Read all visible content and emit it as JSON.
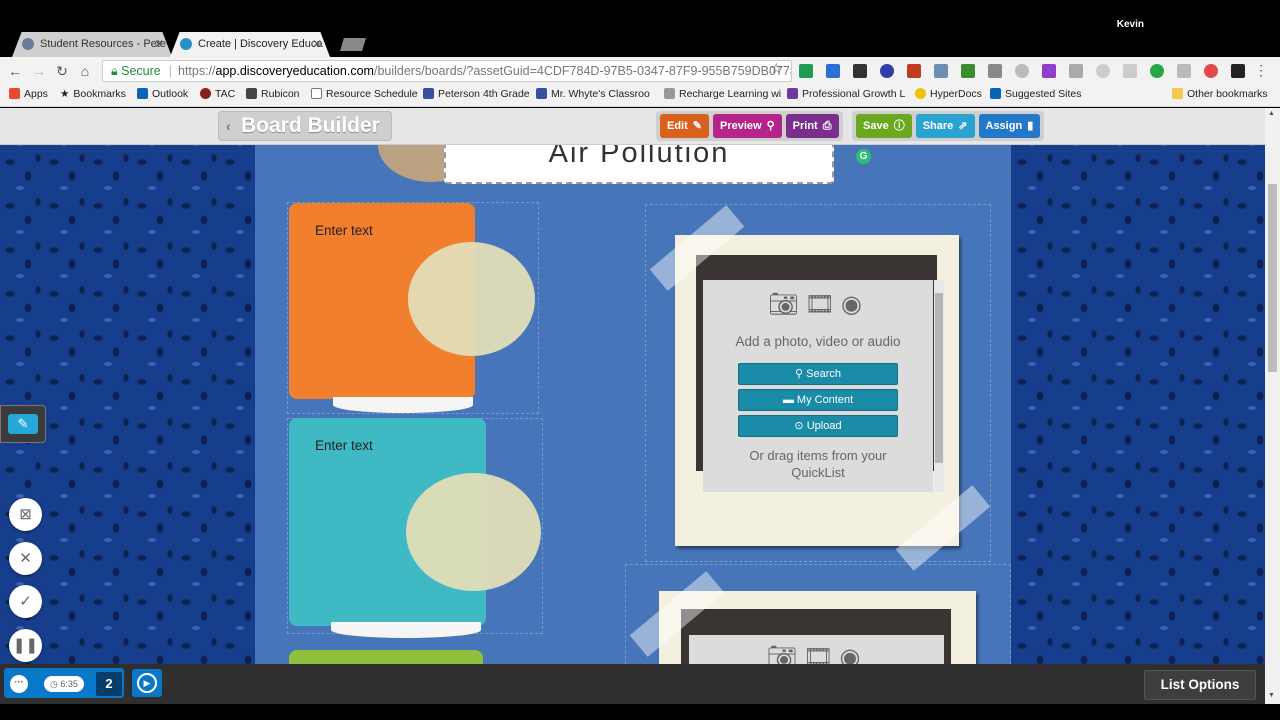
{
  "browser": {
    "tabs": [
      {
        "title": "Student Resources - Pete"
      },
      {
        "title": "Create | Discovery Educa"
      }
    ],
    "user": "Kevin",
    "url": {
      "secure_label": "Secure",
      "scheme": "https://",
      "host": "app.discoveryeducation.com",
      "path": "/builders/boards/?assetGuid=4CDF784D-97B5-0347-87F9-955B759DB077#mo"
    },
    "bookmarks": [
      {
        "label": "Apps",
        "color": "#e6492d"
      },
      {
        "label": "Bookmarks",
        "color": "#555555"
      },
      {
        "label": "Outlook",
        "color": "#0a64b5"
      },
      {
        "label": "TAC",
        "color": "#8b1d1d"
      },
      {
        "label": "Rubicon",
        "color": "#444444"
      },
      {
        "label": "Resource Schedule",
        "color": "#777777"
      },
      {
        "label": "Peterson 4th Grade",
        "color": "#3a4fa0"
      },
      {
        "label": "Mr. Whyte's Classroo",
        "color": "#3a4fa0"
      },
      {
        "label": "Recharge Learning wi",
        "color": "#999999"
      },
      {
        "label": "Professional Growth L",
        "color": "#6c3aa0"
      },
      {
        "label": "HyperDocs",
        "color": "#f2c200"
      },
      {
        "label": "Suggested Sites",
        "color": "#0a64b5"
      }
    ],
    "other_bookmarks": "Other bookmarks"
  },
  "builder": {
    "logo": "Board Builder",
    "buttons": {
      "edit": "Edit",
      "preview": "Preview",
      "print": "Print",
      "save": "Save",
      "share": "Share",
      "assign": "Assign"
    },
    "colors": {
      "edit": "#d9611e",
      "preview": "#b5248a",
      "print": "#7b2f8c",
      "save": "#6aa81f",
      "share": "#2aa3d0",
      "assign": "#2478c8"
    }
  },
  "board": {
    "title": "Air Pollution",
    "cards": [
      {
        "text": "Enter text",
        "color": "#f17f2e"
      },
      {
        "text": "Enter text",
        "color": "#3fb9c3"
      }
    ],
    "media": {
      "add_label": "Add a photo, video or audio",
      "search": "Search",
      "my_content": "My Content",
      "upload": "Upload",
      "drag_text": "Or drag items from your QuickList"
    }
  },
  "recorder": {
    "timer": "6:35",
    "count": "2"
  },
  "footer": {
    "list_options": "List Options"
  }
}
